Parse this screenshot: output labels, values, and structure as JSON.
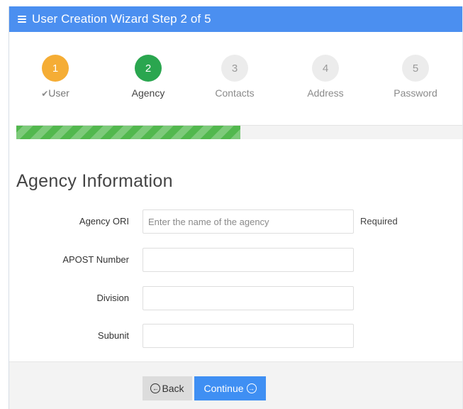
{
  "header": {
    "title": "User Creation Wizard Step 2 of 5",
    "icon": "menu-icon",
    "color": "#4b8ff0"
  },
  "steps": [
    {
      "number": "1",
      "label": "User",
      "state": "done",
      "check_icon": "✔"
    },
    {
      "number": "2",
      "label": "Agency",
      "state": "active"
    },
    {
      "number": "3",
      "label": "Contacts",
      "state": "todo"
    },
    {
      "number": "4",
      "label": "Address",
      "state": "todo"
    },
    {
      "number": "5",
      "label": "Password",
      "state": "todo"
    }
  ],
  "progress": {
    "fraction": 0.5,
    "color": "#52b84e"
  },
  "section": {
    "title": "Agency Information"
  },
  "form": {
    "fields": [
      {
        "label": "Agency ORI",
        "value": "",
        "placeholder": "Enter the name of the agency",
        "hint": "Required"
      },
      {
        "label": "APOST Number",
        "value": "",
        "placeholder": ""
      },
      {
        "label": "Division",
        "value": "",
        "placeholder": ""
      },
      {
        "label": "Subunit",
        "value": "",
        "placeholder": ""
      }
    ]
  },
  "buttons": {
    "back": {
      "label": "Back",
      "icon": "arrow-left-circle-icon",
      "glyph": "←"
    },
    "continue": {
      "label": "Continue",
      "icon": "arrow-right-circle-icon",
      "glyph": "→",
      "color": "#3f8ff3"
    }
  }
}
